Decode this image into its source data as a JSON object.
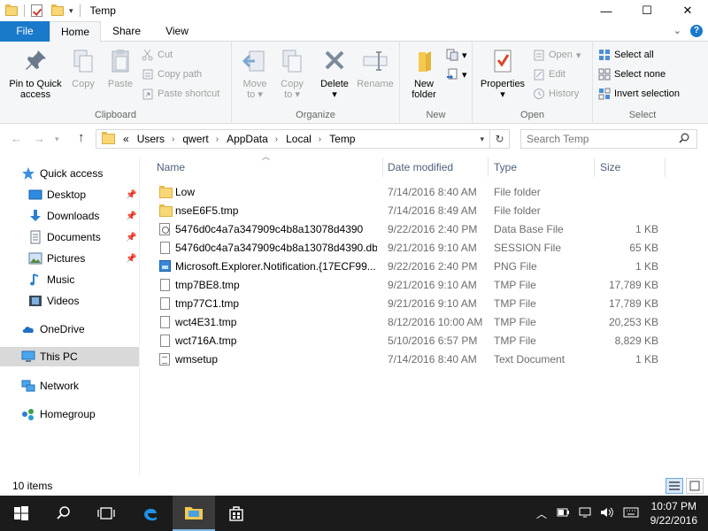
{
  "window": {
    "title": "Temp",
    "controls": {
      "minimize": "—",
      "maximize": "☐",
      "close": "✕"
    }
  },
  "ribbon_tabs": {
    "file": "File",
    "home": "Home",
    "share": "Share",
    "view": "View"
  },
  "ribbon": {
    "clipboard": {
      "label": "Clipboard",
      "pin_line1": "Pin to Quick",
      "pin_line2": "access",
      "copy": "Copy",
      "paste": "Paste",
      "cut": "Cut",
      "copy_path": "Copy path",
      "paste_shortcut": "Paste shortcut"
    },
    "organize": {
      "label": "Organize",
      "move_to_line1": "Move",
      "move_to_line2": "to",
      "copy_to_line1": "Copy",
      "copy_to_line2": "to",
      "delete": "Delete",
      "rename": "Rename"
    },
    "new": {
      "label": "New",
      "new_folder_line1": "New",
      "new_folder_line2": "folder"
    },
    "open": {
      "label": "Open",
      "properties": "Properties",
      "open": "Open",
      "edit": "Edit",
      "history": "History"
    },
    "select": {
      "label": "Select",
      "select_all": "Select all",
      "select_none": "Select none",
      "invert": "Invert selection"
    }
  },
  "address": {
    "crumbs": [
      "«",
      "Users",
      "qwert",
      "AppData",
      "Local",
      "Temp"
    ],
    "search_placeholder": "Search Temp"
  },
  "nav": {
    "quick_access": "Quick access",
    "desktop": "Desktop",
    "downloads": "Downloads",
    "documents": "Documents",
    "pictures": "Pictures",
    "music": "Music",
    "videos": "Videos",
    "onedrive": "OneDrive",
    "this_pc": "This PC",
    "network": "Network",
    "homegroup": "Homegroup"
  },
  "columns": {
    "name": "Name",
    "date": "Date modified",
    "type": "Type",
    "size": "Size"
  },
  "files": [
    {
      "name": "Low",
      "date": "7/14/2016 8:40 AM",
      "type": "File folder",
      "size": "",
      "icon": "folder-icon"
    },
    {
      "name": "nseE6F5.tmp",
      "date": "7/14/2016 8:49 AM",
      "type": "File folder",
      "size": "",
      "icon": "folder-icon"
    },
    {
      "name": "5476d0c4a7a347909c4b8a13078d4390",
      "date": "9/22/2016 2:40 PM",
      "type": "Data Base File",
      "size": "1 KB",
      "icon": "database-file-icon"
    },
    {
      "name": "5476d0c4a7a347909c4b8a13078d4390.db....",
      "date": "9/21/2016 9:10 AM",
      "type": "SESSION File",
      "size": "65 KB",
      "icon": "file-icon"
    },
    {
      "name": "Microsoft.Explorer.Notification.{17ECF99...",
      "date": "9/22/2016 2:40 PM",
      "type": "PNG File",
      "size": "1 KB",
      "icon": "image-file-icon"
    },
    {
      "name": "tmp7BE8.tmp",
      "date": "9/21/2016 9:10 AM",
      "type": "TMP File",
      "size": "17,789 KB",
      "icon": "file-icon"
    },
    {
      "name": "tmp77C1.tmp",
      "date": "9/21/2016 9:10 AM",
      "type": "TMP File",
      "size": "17,789 KB",
      "icon": "file-icon"
    },
    {
      "name": "wct4E31.tmp",
      "date": "8/12/2016 10:00 AM",
      "type": "TMP File",
      "size": "20,253 KB",
      "icon": "file-icon"
    },
    {
      "name": "wct716A.tmp",
      "date": "5/10/2016 6:57 PM",
      "type": "TMP File",
      "size": "8,829 KB",
      "icon": "file-icon"
    },
    {
      "name": "wmsetup",
      "date": "7/14/2016 8:40 AM",
      "type": "Text Document",
      "size": "1 KB",
      "icon": "text-file-icon"
    }
  ],
  "status": {
    "items": "10 items"
  },
  "taskbar": {
    "time": "10:07 PM",
    "date": "9/22/2016"
  },
  "colors": {
    "accent": "#1979ca",
    "selection": "#d9d9d9",
    "taskbar": "#1b1b1b"
  }
}
